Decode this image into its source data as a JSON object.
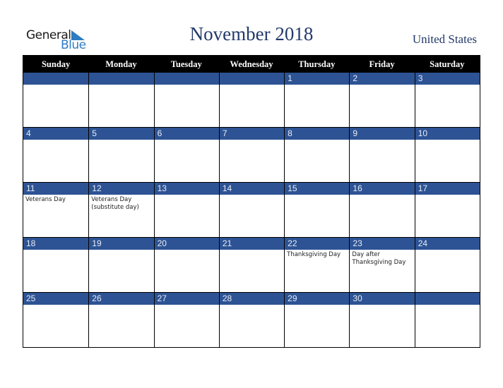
{
  "logo": {
    "general": "General",
    "blue": "Blue"
  },
  "title": "November 2018",
  "country": "United States",
  "colors": {
    "header_bg": "#000000",
    "band_bg": "#2d5394",
    "title": "#233a6b",
    "logo_blue": "#2e7cc4"
  },
  "weekdays": [
    "Sunday",
    "Monday",
    "Tuesday",
    "Wednesday",
    "Thursday",
    "Friday",
    "Saturday"
  ],
  "weeks": [
    [
      {
        "day": "",
        "holiday": ""
      },
      {
        "day": "",
        "holiday": ""
      },
      {
        "day": "",
        "holiday": ""
      },
      {
        "day": "",
        "holiday": ""
      },
      {
        "day": "1",
        "holiday": ""
      },
      {
        "day": "2",
        "holiday": ""
      },
      {
        "day": "3",
        "holiday": ""
      }
    ],
    [
      {
        "day": "4",
        "holiday": ""
      },
      {
        "day": "5",
        "holiday": ""
      },
      {
        "day": "6",
        "holiday": ""
      },
      {
        "day": "7",
        "holiday": ""
      },
      {
        "day": "8",
        "holiday": ""
      },
      {
        "day": "9",
        "holiday": ""
      },
      {
        "day": "10",
        "holiday": ""
      }
    ],
    [
      {
        "day": "11",
        "holiday": "Veterans Day"
      },
      {
        "day": "12",
        "holiday": "Veterans Day (substitute day)"
      },
      {
        "day": "13",
        "holiday": ""
      },
      {
        "day": "14",
        "holiday": ""
      },
      {
        "day": "15",
        "holiday": ""
      },
      {
        "day": "16",
        "holiday": ""
      },
      {
        "day": "17",
        "holiday": ""
      }
    ],
    [
      {
        "day": "18",
        "holiday": ""
      },
      {
        "day": "19",
        "holiday": ""
      },
      {
        "day": "20",
        "holiday": ""
      },
      {
        "day": "21",
        "holiday": ""
      },
      {
        "day": "22",
        "holiday": "Thanksgiving Day"
      },
      {
        "day": "23",
        "holiday": "Day after Thanksgiving Day"
      },
      {
        "day": "24",
        "holiday": ""
      }
    ],
    [
      {
        "day": "25",
        "holiday": ""
      },
      {
        "day": "26",
        "holiday": ""
      },
      {
        "day": "27",
        "holiday": ""
      },
      {
        "day": "28",
        "holiday": ""
      },
      {
        "day": "29",
        "holiday": ""
      },
      {
        "day": "30",
        "holiday": ""
      },
      {
        "day": "",
        "holiday": ""
      }
    ]
  ]
}
